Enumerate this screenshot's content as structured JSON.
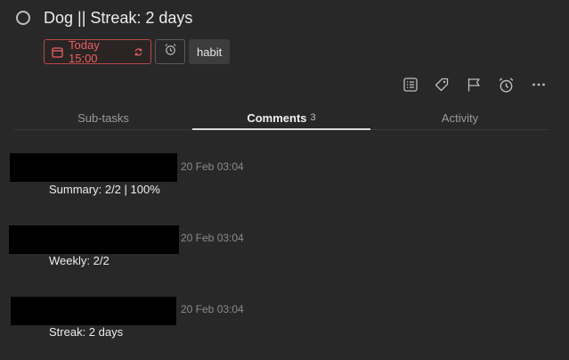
{
  "task": {
    "title": "Dog || Streak: 2 days",
    "completed": false
  },
  "meta": {
    "date_label": "Today 15:00",
    "date_color": "#e8615f",
    "tag": "habit"
  },
  "toolbar": {
    "icons": [
      "list-icon",
      "tag-icon",
      "flag-icon",
      "alarm-icon",
      "more-icon"
    ]
  },
  "tabs": [
    {
      "label": "Sub-tasks",
      "count": "",
      "active": false
    },
    {
      "label": "Comments",
      "count": "3",
      "active": true
    },
    {
      "label": "Activity",
      "count": "",
      "active": false
    }
  ],
  "comments": [
    {
      "time": "20 Feb 03:04",
      "body": "Summary: 2/2 | 100%"
    },
    {
      "time": "20 Feb 03:04",
      "body": "Weekly: 2/2"
    },
    {
      "time": "20 Feb 03:04",
      "body": "Streak: 2 days"
    }
  ]
}
